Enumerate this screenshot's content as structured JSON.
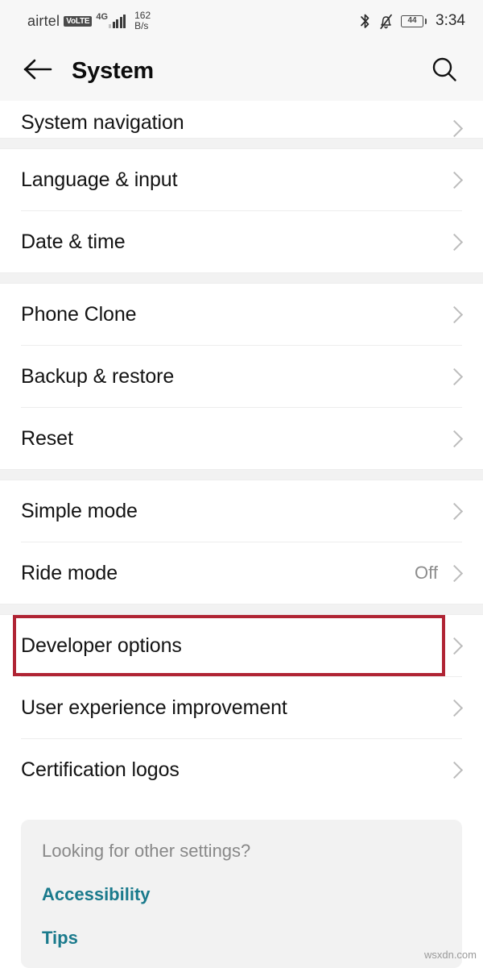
{
  "status_bar": {
    "carrier": "airtel",
    "volte_badge": "VoLTE",
    "network_type": "4G",
    "data_speed_value": "162",
    "data_speed_unit": "B/s",
    "bluetooth_icon": "bluetooth-icon",
    "silent_icon": "bell-muted-icon",
    "battery_level": "44",
    "time": "3:34"
  },
  "app_bar": {
    "back_icon": "back-arrow-icon",
    "title": "System",
    "search_icon": "search-icon"
  },
  "groups": [
    {
      "rows": [
        {
          "label": "System navigation",
          "value": "",
          "clipped": true,
          "highlighted": false
        }
      ]
    },
    {
      "rows": [
        {
          "label": "Language & input",
          "value": "",
          "clipped": false,
          "highlighted": false
        },
        {
          "label": "Date & time",
          "value": "",
          "clipped": false,
          "highlighted": false
        }
      ]
    },
    {
      "rows": [
        {
          "label": "Phone Clone",
          "value": "",
          "clipped": false,
          "highlighted": false
        },
        {
          "label": "Backup & restore",
          "value": "",
          "clipped": false,
          "highlighted": false
        },
        {
          "label": "Reset",
          "value": "",
          "clipped": false,
          "highlighted": false
        }
      ]
    },
    {
      "rows": [
        {
          "label": "Simple mode",
          "value": "",
          "clipped": false,
          "highlighted": false
        },
        {
          "label": "Ride mode",
          "value": "Off",
          "clipped": false,
          "highlighted": false
        }
      ]
    },
    {
      "rows": [
        {
          "label": "Developer options",
          "value": "",
          "clipped": false,
          "highlighted": true
        },
        {
          "label": "User experience improvement",
          "value": "",
          "clipped": false,
          "highlighted": false
        },
        {
          "label": "Certification logos",
          "value": "",
          "clipped": false,
          "highlighted": false
        }
      ]
    }
  ],
  "footer": {
    "title": "Looking for other settings?",
    "links": [
      "Accessibility",
      "Tips"
    ]
  },
  "watermark": "wsxdn.com",
  "colors": {
    "annotation_red": "#b02434",
    "link_teal": "#1a7a8c",
    "chevron_grey": "#bcbcbc",
    "group_gap": "#f2f2f2",
    "appbar_bg": "#f7f7f7"
  }
}
